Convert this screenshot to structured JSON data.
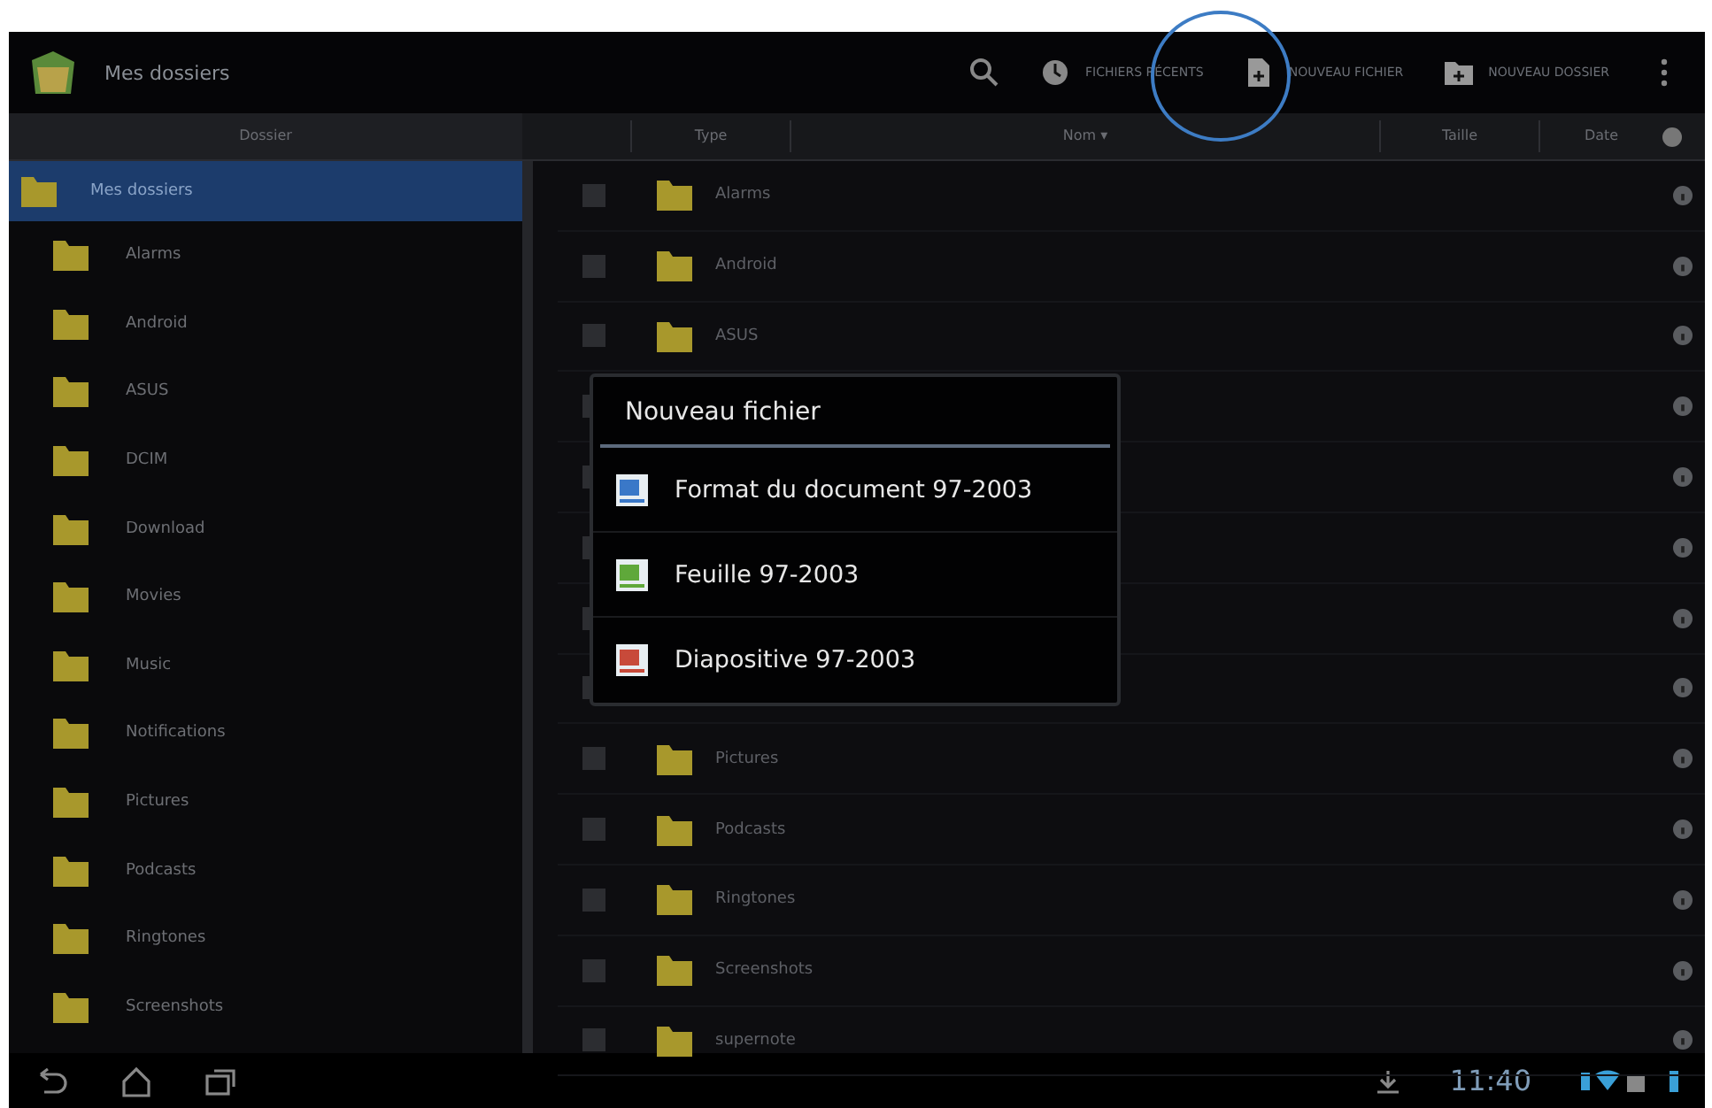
{
  "action_bar": {
    "title": "Mes dossiers",
    "actions": [
      {
        "kind": "search"
      },
      {
        "kind": "recent",
        "label": "FICHIERS RÉCENTS"
      },
      {
        "kind": "new_file",
        "label": "NOUVEAU FICHIER",
        "highlighted": true
      },
      {
        "kind": "new_folder",
        "label": "NOUVEAU DOSSIER"
      },
      {
        "kind": "overflow"
      }
    ]
  },
  "sidebar": {
    "heading": "Dossier",
    "root": {
      "label": "Mes dossiers",
      "selected": true,
      "children": [
        {
          "label": "Alarms",
          "selected": false
        },
        {
          "label": "Android",
          "selected": false
        },
        {
          "label": "ASUS",
          "selected": false
        },
        {
          "label": "DCIM",
          "selected": false
        },
        {
          "label": "Download",
          "selected": false
        },
        {
          "label": "Movies",
          "selected": false
        },
        {
          "label": "Music",
          "selected": false
        },
        {
          "label": "Notifications",
          "selected": false
        },
        {
          "label": "Pictures",
          "selected": false
        },
        {
          "label": "Podcasts",
          "selected": false
        },
        {
          "label": "Ringtones",
          "selected": false
        },
        {
          "label": "Screenshots",
          "selected": false
        }
      ]
    }
  },
  "table": {
    "columns": [
      "Type",
      "Nom ▾",
      "Taille",
      "Date"
    ],
    "rows": [
      {
        "name": "Alarms",
        "checked": false
      },
      {
        "name": "Android",
        "checked": false
      },
      {
        "name": "ASUS",
        "checked": false
      },
      {
        "checked": false
      },
      {
        "checked": false
      },
      {
        "checked": false
      },
      {
        "checked": false
      },
      {
        "checked": false
      },
      {
        "name": "Pictures",
        "checked": false
      },
      {
        "name": "Podcasts",
        "checked": false
      },
      {
        "name": "Ringtones",
        "checked": false
      },
      {
        "name": "Screenshots",
        "checked": false
      },
      {
        "name": "supernote",
        "checked": false
      }
    ]
  },
  "dialog": {
    "title": "Nouveau fichier",
    "items": [
      {
        "kind": "document",
        "label": "Format du document 97-2003"
      },
      {
        "kind": "sheet",
        "label": "Feuille 97-2003"
      },
      {
        "kind": "slides",
        "label": "Diapositive 97-2003"
      }
    ]
  },
  "system_bar": {
    "time": "11:40"
  }
}
